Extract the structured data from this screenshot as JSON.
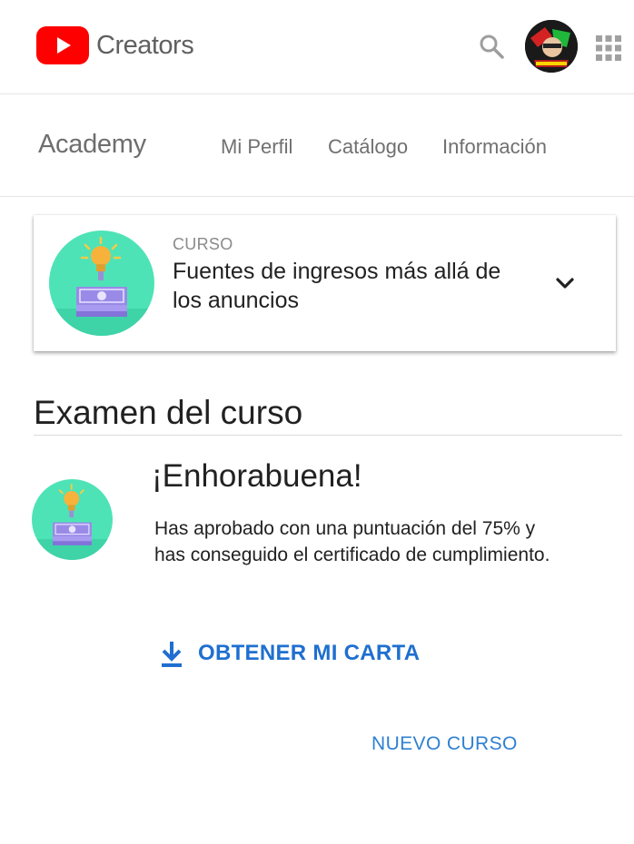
{
  "header": {
    "brand": "Creators",
    "logo_icon": "youtube-play-icon",
    "search_icon": "search-icon",
    "apps_icon": "apps-grid-icon",
    "brand_color": "#ff0000"
  },
  "subnav": {
    "title": "Academy",
    "links": [
      {
        "label": "Mi Perfil"
      },
      {
        "label": "Catálogo"
      },
      {
        "label": "Información"
      }
    ]
  },
  "course": {
    "kicker": "CURSO",
    "title": "Fuentes de ingresos más allá de los anuncios",
    "icon": "money-lightbulb-icon",
    "expand_icon": "chevron-down-icon",
    "icon_bg_color": "#4ee3b6"
  },
  "exam": {
    "title": "Examen del curso",
    "congrats": "¡Enhorabuena!",
    "message": "Has aprobado con una puntuación del 75% y has conseguido el certificado de cumplimiento.",
    "download_icon": "download-icon",
    "letter_button": "OBTENER MI CARTA",
    "new_course_button": "NUEVO CURSO",
    "accent_color": "#1f6fd0"
  }
}
